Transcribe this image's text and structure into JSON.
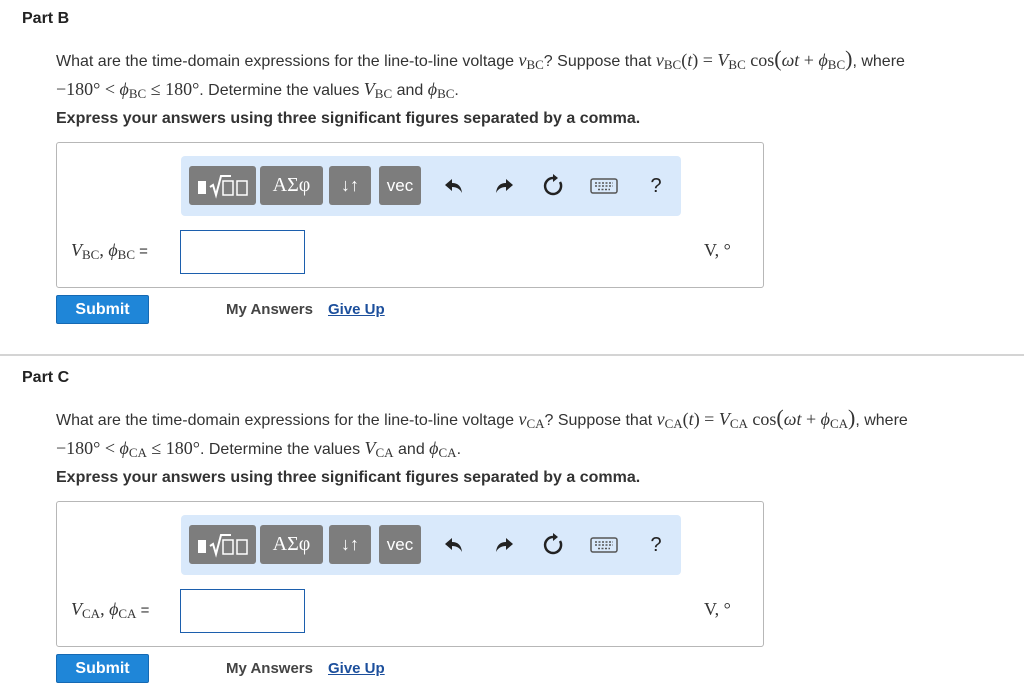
{
  "parts": [
    {
      "title": "Part B",
      "question_pre": "What are the time-domain expressions for the line-to-line voltage ",
      "var": "v",
      "sub": "BC",
      "question_mid": "? Suppose that ",
      "phase_sym": "ϕ",
      "cap": "V",
      "where": ", where",
      "range_pre": "−180° < ",
      "range_post": " ≤ 180°",
      "question_end": ". Determine the values ",
      "and": " and ",
      "instruction": "Express your answers using three significant figures separated by a comma.",
      "answer_label": "V_BC, ϕ_BC =",
      "units": "V, °",
      "submit": "Submit",
      "my_answers": "My Answers",
      "give_up": "Give Up"
    },
    {
      "title": "Part C",
      "question_pre": "What are the time-domain expressions for the line-to-line voltage ",
      "var": "v",
      "sub": "CA",
      "question_mid": "? Suppose that ",
      "phase_sym": "ϕ",
      "cap": "V",
      "where": ", where",
      "range_pre": "−180° < ",
      "range_post": " ≤ 180°",
      "question_end": ". Determine the values ",
      "and": " and ",
      "instruction": "Express your answers using three significant figures separated by a comma.",
      "answer_label": "V_CA, ϕ_CA =",
      "units": "V, °",
      "submit": "Submit",
      "my_answers": "My Answers",
      "give_up": "Give Up"
    }
  ],
  "toolbar": {
    "templates_icon": "templates-icon",
    "greek": "ΑΣφ",
    "arrows": "↓↑",
    "vec": "vec",
    "undo_icon": "undo-icon",
    "redo_icon": "redo-icon",
    "reset_icon": "reset-icon",
    "keyboard_icon": "keyboard-icon",
    "help": "?"
  }
}
